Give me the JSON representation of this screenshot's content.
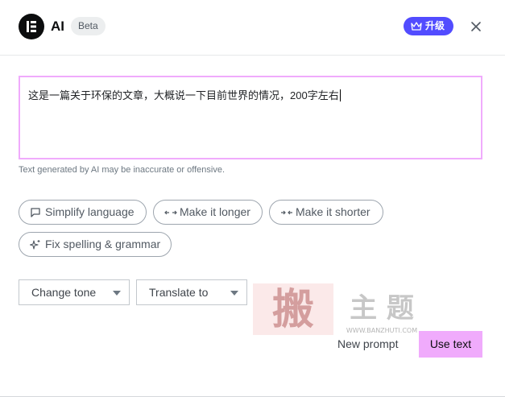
{
  "header": {
    "app_title": "AI",
    "beta_label": "Beta",
    "upgrade_label": "升级",
    "accent_color": "#524cff"
  },
  "prompt": {
    "text": "这是一篇关于环保的文章，大概说一下目前世界的情况，200字左右",
    "border_color": "#f0abfc"
  },
  "disclaimer": "Text generated by AI may be inaccurate or offensive.",
  "chips": [
    {
      "label": "Simplify language",
      "icon": "speech-bubble-icon"
    },
    {
      "label": "Make it longer",
      "icon": "expand-arrows-icon"
    },
    {
      "label": "Make it shorter",
      "icon": "collapse-arrows-icon"
    },
    {
      "label": "Fix spelling & grammar",
      "icon": "sparkle-icon"
    }
  ],
  "selects": {
    "tone": "Change tone",
    "translate": "Translate to"
  },
  "actions": {
    "new_prompt": "New prompt",
    "use_text": "Use text",
    "use_text_color": "#f0abfc"
  },
  "watermark": {
    "text": "主 题",
    "url": "WWW.BANZHUTI.COM"
  }
}
